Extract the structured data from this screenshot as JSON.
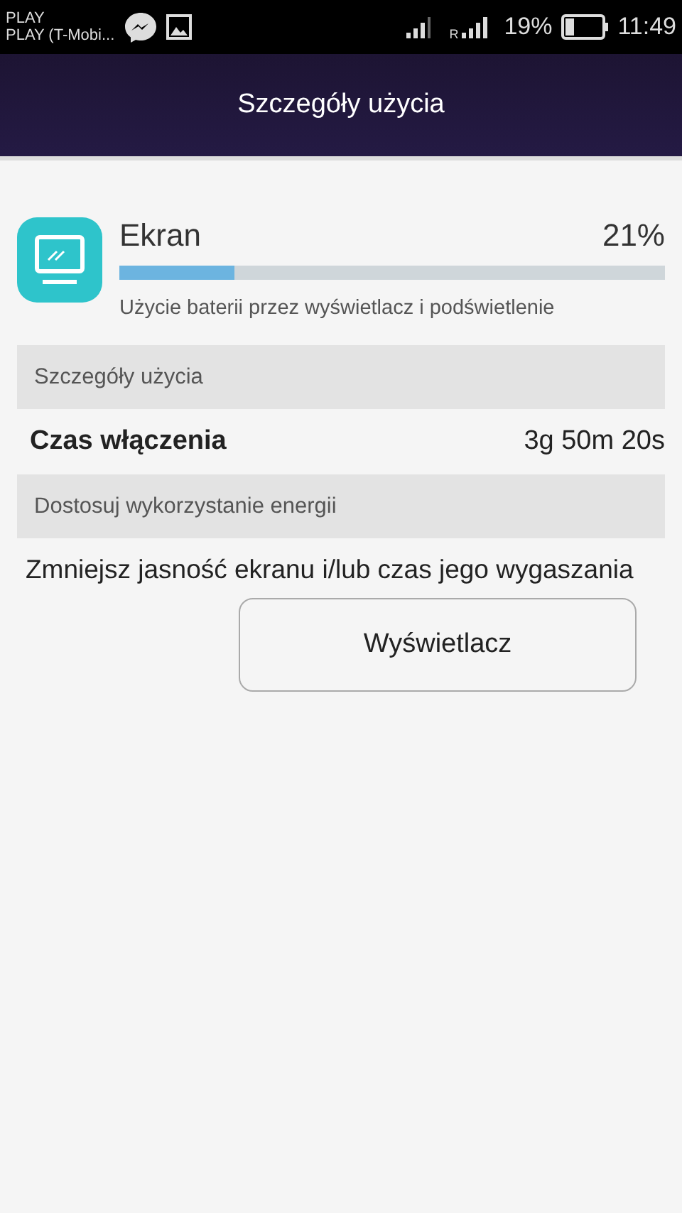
{
  "status_bar": {
    "carrier_1": "PLAY",
    "carrier_2": "PLAY (T-Mobi...",
    "roaming": "R",
    "battery_text": "19%",
    "time": "11:49"
  },
  "title_bar": {
    "title": "Szczegóły użycia"
  },
  "app": {
    "name": "Ekran",
    "percent": "21%",
    "level": 0.21,
    "description": "Użycie baterii przez wyświetlacz i podświetlenie"
  },
  "sections": [
    {
      "header": "Szczegóły użycia",
      "rows": [
        {
          "label": "Czas włączenia",
          "value": "3g 50m 20s"
        }
      ]
    },
    {
      "header": "Dostosuj wykorzystanie energii",
      "text": "Zmniejsz jasność ekranu i/lub czas jego wygaszania",
      "button": "Wyświetlacz"
    }
  ]
}
